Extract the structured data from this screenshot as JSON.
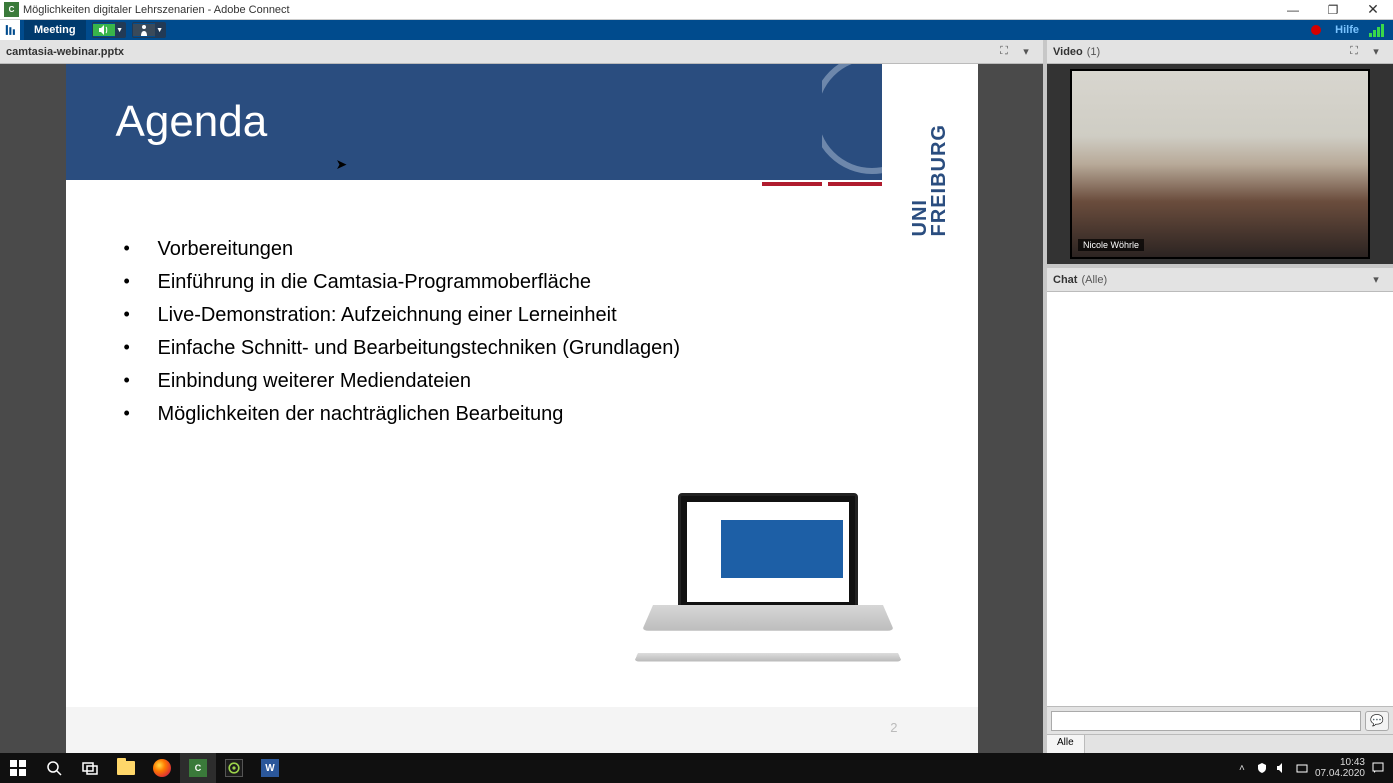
{
  "window": {
    "app_icon_letter": "C",
    "title": "Möglichkeiten digitaler Lehrszenarien - Adobe Connect",
    "minimize": "—",
    "maximize": "❐",
    "close": "✕"
  },
  "toolbar": {
    "meeting_label": "Meeting",
    "help_label": "Hilfe"
  },
  "share_pane": {
    "filename": "camtasia-webinar.pptx",
    "fullscreen_tip": "⛶",
    "menu_tip": "▾"
  },
  "slide": {
    "title": "Agenda",
    "uni_logo_text": "UNI\nFREIBURG",
    "bullets": [
      "Vorbereitungen",
      "Einführung in die Camtasia-Programmoberfläche",
      "Live-Demonstration: Aufzeichnung einer Lerneinheit",
      "Einfache Schnitt- und Bearbeitungstechniken (Grundlagen)",
      "Einbindung weiterer Mediendateien",
      "Möglichkeiten der nachträglichen Bearbeitung"
    ],
    "page_number": "2"
  },
  "video_pane": {
    "title": "Video",
    "count_suffix": "(1)",
    "presenter_name": "Nicole Wöhrle"
  },
  "chat_pane": {
    "title": "Chat",
    "scope_suffix": "(Alle)",
    "tab_all": "Alle",
    "input_placeholder": "",
    "send_glyph": "💬"
  },
  "taskbar": {
    "time": "10:43",
    "date": "07.04.2020"
  }
}
